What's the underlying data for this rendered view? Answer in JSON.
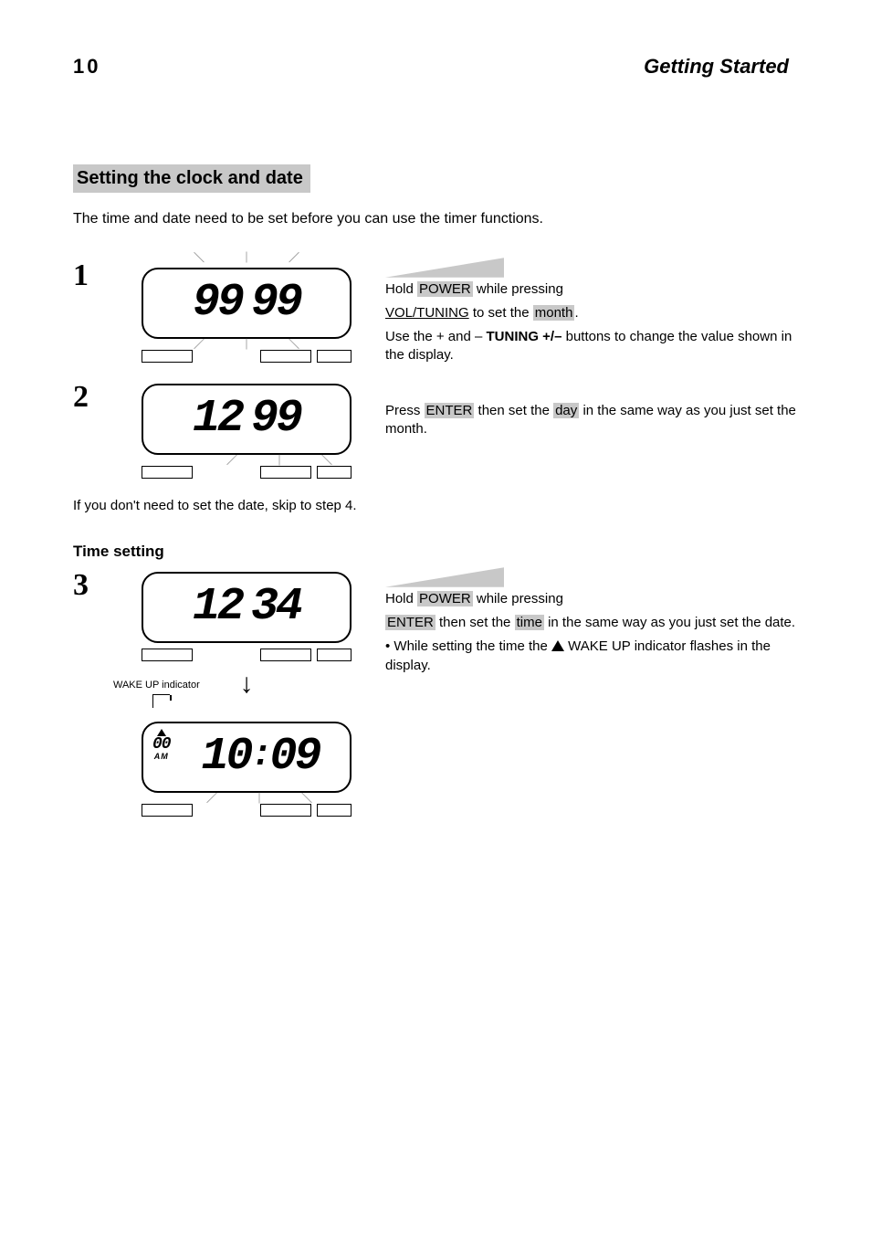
{
  "page_number": "10",
  "page_title": "Getting Started",
  "section_heading": "Setting the clock and date",
  "intro": "The time and date need to be set before you can use the timer functions.",
  "step1": {
    "num": "1",
    "lcd": {
      "digits_left": "99",
      "digits_right": "99"
    },
    "text_1a": "Hold ",
    "text_1b": " while pressing",
    "text_2a": " to set the ",
    "hl_month": "month",
    "text_2b": ".",
    "text_3a": "Use the + and – ",
    "text_3b": " buttons to change the value shown in the display."
  },
  "step2": {
    "num": "2",
    "lcd": {
      "digits_left": "12",
      "digits_right": "99"
    },
    "text_2a": "Press ",
    "hl_enter": "ENTER",
    "text_2b": " then set the ",
    "hl_day": "day",
    "text_2c": " in the same way as you just set the month."
  },
  "skipnote": "If you don't need to set the date, skip to step 4.",
  "subhead": "Time setting",
  "step3": {
    "num": "3",
    "lcd_top": {
      "digits_left": "12",
      "digits_right": "34"
    },
    "lcd_bot": {
      "small_top": "00",
      "am": "AM",
      "digits_left": "10",
      "digits_right": "09",
      "colon": ":"
    },
    "wake_label": "WAKE UP indicator",
    "text_1a": "Hold ",
    "text_1b": " while pressing",
    "text_2a": " ",
    "hl_enter": "ENTER",
    "text_2b": " then set the ",
    "hl_time": "time",
    "text_2c": " in the same way as you just set the date.",
    "bullet_1a": "While setting the time the ",
    "bullet_1b": " WAKE UP indicator flashes in the display."
  },
  "labels": {
    "vol_tuning": "VOL/TUNING",
    "power": "POWER",
    "tuning_plus_minus": "TUNING +/–"
  }
}
